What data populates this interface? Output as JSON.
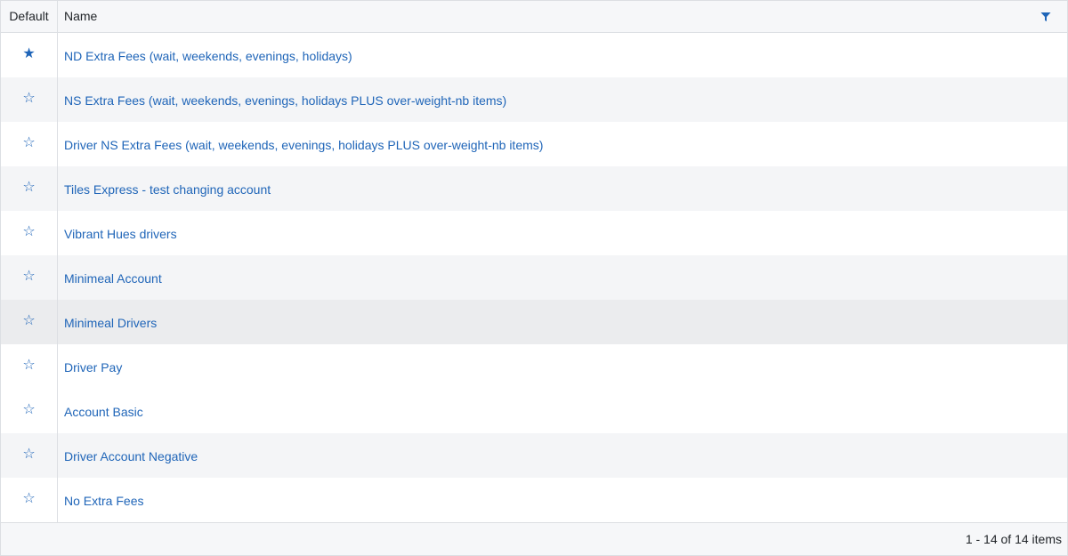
{
  "header": {
    "default_label": "Default",
    "name_label": "Name",
    "filter_icon": "filter-icon"
  },
  "rows": [
    {
      "name": "ND Extra Fees (wait, weekends, evenings, holidays)",
      "star": "★",
      "is_default": true
    },
    {
      "name": "NS Extra Fees (wait, weekends, evenings, holidays PLUS over-weight-nb items)",
      "star": "☆",
      "is_default": false
    },
    {
      "name": "Driver NS Extra Fees (wait, weekends, evenings, holidays PLUS over-weight-nb items)",
      "star": "☆",
      "is_default": false
    },
    {
      "name": "Tiles Express - test changing account",
      "star": "☆",
      "is_default": false
    },
    {
      "name": "Vibrant Hues drivers",
      "star": "☆",
      "is_default": false
    },
    {
      "name": "Minimeal Account",
      "star": "☆",
      "is_default": false
    },
    {
      "name": "Minimeal Drivers",
      "star": "☆",
      "is_default": false
    },
    {
      "name": "Driver Pay",
      "star": "☆",
      "is_default": false
    },
    {
      "name": "Account Basic",
      "star": "☆",
      "is_default": false
    },
    {
      "name": "Driver Account Negative",
      "star": "☆",
      "is_default": false
    },
    {
      "name": "No Extra Fees",
      "star": "☆",
      "is_default": false
    }
  ],
  "footer": {
    "pager_info": "1 - 14 of 14 items"
  },
  "colors": {
    "link": "#1f65b8",
    "header_bg": "#f6f7f9",
    "alt_row_bg": "#f4f5f7",
    "hover_row_bg": "#ebecee",
    "border": "#dcdfe3"
  }
}
